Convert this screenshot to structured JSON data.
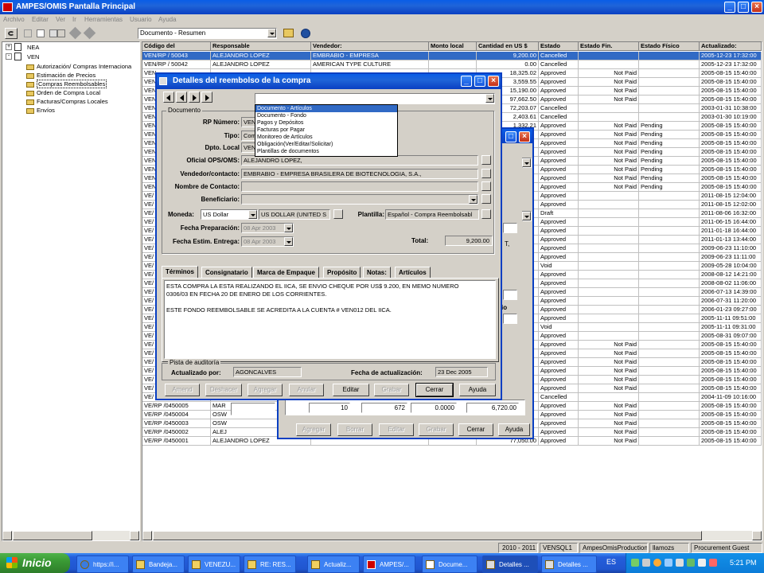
{
  "app": {
    "title": "AMPES/OMIS Pantalla Principal",
    "title_min": "_",
    "title_max": "□",
    "title_close": "×"
  },
  "menu": [
    "Archivo",
    "Editar",
    "Ver",
    "Ir",
    "Herramientas",
    "Usuario",
    "Ayuda"
  ],
  "toolbar": {
    "view_select": "Documento - Resumen"
  },
  "tree": [
    {
      "label": "NEA",
      "level": 0,
      "expander": "+"
    },
    {
      "label": "VEN",
      "level": 0,
      "expander": "-"
    },
    {
      "label": "Autorización/ Compras Internaciona",
      "level": 1
    },
    {
      "label": "Estimación de Precios",
      "level": 1
    },
    {
      "label": "Compras Reembolsables",
      "level": 1,
      "selected": true
    },
    {
      "label": "Orden de Compra Local",
      "level": 1
    },
    {
      "label": "Facturas/Compras Locales",
      "level": 1
    },
    {
      "label": "Envíos",
      "level": 1
    }
  ],
  "grid": {
    "headers": [
      "Código del",
      "Responsable",
      "Vendedor:",
      "Monto local",
      "Cantidad en US $",
      "Estado",
      "Estado Fin.",
      "Estado Físico",
      "Actualizado:"
    ],
    "rows": [
      [
        "VEN/RP / 50043",
        "ALEJANDRO LOPEZ",
        "EMBRABIO - EMPRESA",
        "",
        "9,200.00",
        "Cancelled",
        "",
        "",
        "2005-12-23 17:32:00"
      ],
      [
        "VEN/RP / 50042",
        "ALEJANDRO LOPEZ",
        "AMERICAN TYPE CULTURE",
        "",
        "0.00",
        "Cancelled",
        "",
        "",
        "2005-12-23 17:32:00"
      ],
      [
        "VEN",
        "",
        "",
        "",
        "18,325.02",
        "Approved",
        "Not Paid",
        "",
        "2005-08-15 15:40:00"
      ],
      [
        "VEN",
        "",
        "",
        "",
        "3,559.55",
        "Approved",
        "Not Paid",
        "",
        "2005-08-15 15:40:00"
      ],
      [
        "VEN",
        "",
        "",
        "",
        "15,190.00",
        "Approved",
        "Not Paid",
        "",
        "2005-08-15 15:40:00"
      ],
      [
        "VEN",
        "",
        "",
        "",
        "97,662.50",
        "Approved",
        "Not Paid",
        "",
        "2005-08-15 15:40:00"
      ],
      [
        "VEN",
        "",
        "",
        "",
        "72,203.07",
        "Cancelled",
        "",
        "",
        "2003-01-31 10:38:00"
      ],
      [
        "VEN",
        "",
        "",
        "",
        "2,403.61",
        "Cancelled",
        "",
        "",
        "2003-01-30 10:19:00"
      ],
      [
        "VEN",
        "",
        "",
        "",
        "1,332.21",
        "Approved",
        "Not Paid",
        "Pending",
        "2005-08-15 15:40:00"
      ],
      [
        "VEN",
        "",
        "",
        "",
        "",
        "Approved",
        "Not Paid",
        "Pending",
        "2005-08-15 15:40:00"
      ],
      [
        "VEN",
        "",
        "",
        "",
        "",
        "Approved",
        "Not Paid",
        "Pending",
        "2005-08-15 15:40:00"
      ],
      [
        "VEN",
        "",
        "",
        "",
        "",
        "Approved",
        "Not Paid",
        "Pending",
        "2005-08-15 15:40:00"
      ],
      [
        "VEN",
        "",
        "",
        "",
        "",
        "Approved",
        "Not Paid",
        "Pending",
        "2005-08-15 15:40:00"
      ],
      [
        "VEN",
        "",
        "",
        "",
        "",
        "Approved",
        "Not Paid",
        "Pending",
        "2005-08-15 15:40:00"
      ],
      [
        "VEN",
        "",
        "",
        "",
        "",
        "Approved",
        "Not Paid",
        "Pending",
        "2005-08-15 15:40:00"
      ],
      [
        "VEN",
        "",
        "",
        "",
        "",
        "Approved",
        "Not Paid",
        "Pending",
        "2005-08-15 15:40:00"
      ],
      [
        "VE/",
        "",
        "",
        "",
        "",
        "Approved",
        "",
        "",
        "2011-08-15 12:04:00"
      ],
      [
        "VE/",
        "",
        "",
        "",
        "",
        "Approved",
        "",
        "",
        "2011-08-15 12:02:00"
      ],
      [
        "VE/",
        "",
        "",
        "",
        "",
        "Draft",
        "",
        "",
        "2011-08-06 16:32:00"
      ],
      [
        "VE/",
        "",
        "",
        "",
        "",
        "Approved",
        "",
        "",
        "2011-06-15 16:44:00"
      ],
      [
        "VE/",
        "",
        "",
        "",
        "",
        "Approved",
        "",
        "",
        "2011-01-18 16:44:00"
      ],
      [
        "VE/",
        "",
        "",
        "",
        "",
        "Approved",
        "",
        "",
        "2011-01-13 13:44:00"
      ],
      [
        "VE/",
        "",
        "",
        "",
        "",
        "Approved",
        "",
        "",
        "2009-06-23 11:10:00"
      ],
      [
        "VE/",
        "",
        "",
        "",
        "",
        "Approved",
        "",
        "",
        "2009-06-23 11:11:00"
      ],
      [
        "VE/",
        "",
        "",
        "",
        "",
        "Void",
        "",
        "",
        "2009-05-28 10:04:00"
      ],
      [
        "VE/",
        "",
        "",
        "",
        "",
        "Approved",
        "",
        "",
        "2008-08-12 14:21:00"
      ],
      [
        "VE/",
        "",
        "",
        "",
        "",
        "Approved",
        "",
        "",
        "2008-08-02 11:06:00"
      ],
      [
        "VE/",
        "",
        "",
        "",
        "",
        "Approved",
        "",
        "",
        "2006-07-13 14:39:00"
      ],
      [
        "VE/",
        "",
        "",
        "",
        "",
        "Approved",
        "",
        "",
        "2006-07-31 11:20:00"
      ],
      [
        "VE/",
        "",
        "",
        "",
        "",
        "Approved",
        "",
        "",
        "2006-01-23 09:27:00"
      ],
      [
        "VE/",
        "",
        "",
        "",
        "",
        "Approved",
        "",
        "",
        "2005-11-11 09:51:00"
      ],
      [
        "VE/",
        "",
        "",
        "",
        "",
        "Void",
        "",
        "",
        "2005-11-11 09:31:00"
      ],
      [
        "VE/",
        "",
        "",
        "",
        "",
        "Approved",
        "",
        "",
        "2005-08-31 09:07:00"
      ],
      [
        "VE/",
        "",
        "",
        "",
        "",
        "Approved",
        "Not Paid",
        "",
        "2005-08-15 15:40:00"
      ],
      [
        "VE/",
        "",
        "",
        "",
        "",
        "Approved",
        "Not Paid",
        "",
        "2005-08-15 15:40:00"
      ],
      [
        "VE/",
        "",
        "",
        "",
        "",
        "Approved",
        "Not Paid",
        "",
        "2005-08-15 15:40:00"
      ],
      [
        "VE/",
        "",
        "",
        "",
        "",
        "Approved",
        "Not Paid",
        "",
        "2005-08-15 15:40:00"
      ],
      [
        "VE/",
        "",
        "",
        "",
        "",
        "Approved",
        "Not Paid",
        "",
        "2005-08-15 15:40:00"
      ],
      [
        "VE/",
        "",
        "",
        "",
        "",
        "Approved",
        "Not Paid",
        "",
        "2005-08-15 15:40:00"
      ],
      [
        "VE/",
        "",
        "",
        "",
        "",
        "Cancelled",
        "",
        "",
        "2004-11-09 10:16:00"
      ],
      [
        "VE/RP /0450005",
        "MAR",
        "",
        "",
        "",
        "Approved",
        "Not Paid",
        "",
        "2005-08-15 15:40:00"
      ],
      [
        "VE/RP /0450004",
        "OSW",
        "",
        "",
        "",
        "Approved",
        "Not Paid",
        "",
        "2005-08-15 15:40:00"
      ],
      [
        "VE/RP /0450003",
        "OSW",
        "",
        "",
        "",
        "Approved",
        "Not Paid",
        "",
        "2005-08-15 15:40:00"
      ],
      [
        "VE/RP /0450002",
        "ALEJ",
        "",
        "",
        "",
        "Approved",
        "Not Paid",
        "",
        "2005-08-15 15:40:00"
      ],
      [
        "VE/RP /0450001",
        "ALEJANDRO LOPEZ",
        "",
        "",
        "77,050.00",
        "Approved",
        "Not Paid",
        "",
        "2005-08-15 15:40:00"
      ]
    ]
  },
  "statusbar": [
    "2010 - 2011",
    "VENSQL1",
    "AmpesOmisProduction",
    "llamozs",
    "Procurement Guest"
  ],
  "back_dialog": {
    "row_values": [
      "10",
      "672",
      "0.0000",
      "6,720.00"
    ],
    "partial_text": [
      "T,",
      "io"
    ],
    "buttons": [
      "Agregar",
      "Borrar",
      "Editar",
      "Grabar",
      "Cerrar",
      "Ayuda"
    ]
  },
  "dialog": {
    "title": "Detalles del reembolso de la  compra",
    "group_documento": "Documento",
    "rp_numero_label": "RP Número:",
    "rp_numero_value": "VEN",
    "tipo_label": "Tipo:",
    "tipo_value": "Com",
    "dpto_label": "Dpto. Local",
    "dpto_value": "VEN",
    "oficial_label": "Oficial OPS/OMS:",
    "oficial_value": "ALEJANDRO LOPEZ,",
    "vendedor_label": "Vendedor/contacto:",
    "vendedor_value": "EMBRABIO - EMPRESA BRASILERA DE BIOTECNOLOGIA, S.A.,",
    "contacto_label": "Nombre de Contacto:",
    "beneficiario_label": "Beneficiario:",
    "moneda_label": "Moneda:",
    "moneda_value": "US Dollar",
    "moneda_desc": "US DOLLAR (UNITED S",
    "plantilla_label": "Plantilla:",
    "plantilla_value": "Español -  Compra Reembolsabl",
    "fecha_prep_label": "Fecha Preparación:",
    "fecha_prep_value": "08 Apr 2003",
    "fecha_est_label": "Fecha Estim. Entrega:",
    "fecha_est_value": "08 Apr 2003",
    "total_label": "Total:",
    "total_value": "9,200.00",
    "tabs": [
      "Términos",
      "Consignatario",
      "Marca de Empaque",
      "Propósito",
      "Notas:",
      "Artículos"
    ],
    "terms_text_1": "ESTA COMPRA LA ESTA REALIZANDO EL IICA, SE ENVIO CHEQUE POR US$ 9.200, EN MEMO NUMERO",
    "terms_text_2": "0306/03 EN FECHA 20 DE ENERO DE LOS CORRIENTES.",
    "terms_text_3": "ESTE FONDO REEMBOLSABLE SE ACREDITA A LA CUENTA # VEN012 DEL IICA.",
    "audit_label": "Pista de auditoría",
    "actualizado_por_label": "Actualizado por:",
    "actualizado_por_value": "AGONCALVES",
    "fecha_act_label": "Fecha de actualización:",
    "fecha_act_value": "23 Dec 2005",
    "buttons": [
      "Amend",
      "Deshacer",
      "Agregar",
      "Anular",
      "Editar",
      "Grabar",
      "Cerrar",
      "Ayuda"
    ],
    "dropdown_options": [
      "Documento - Artículos",
      "Documento - Fondo",
      "Pagos y Depósitos",
      "Facturas por Pagar",
      "Monitoreo de Artículos",
      "Obligación(Ver/Editar/Solicitar)",
      "Plantillas de documentos"
    ]
  },
  "taskbar": {
    "start": "Inicio",
    "items": [
      "https://i...",
      "Bandeja...",
      "VENEZU...",
      "RE: RES...",
      "Actualiz...",
      "AMPES/...",
      "Docume...",
      "Detalles ...",
      "Detalles ..."
    ],
    "lang": "ES",
    "clock": "5:21 PM"
  }
}
